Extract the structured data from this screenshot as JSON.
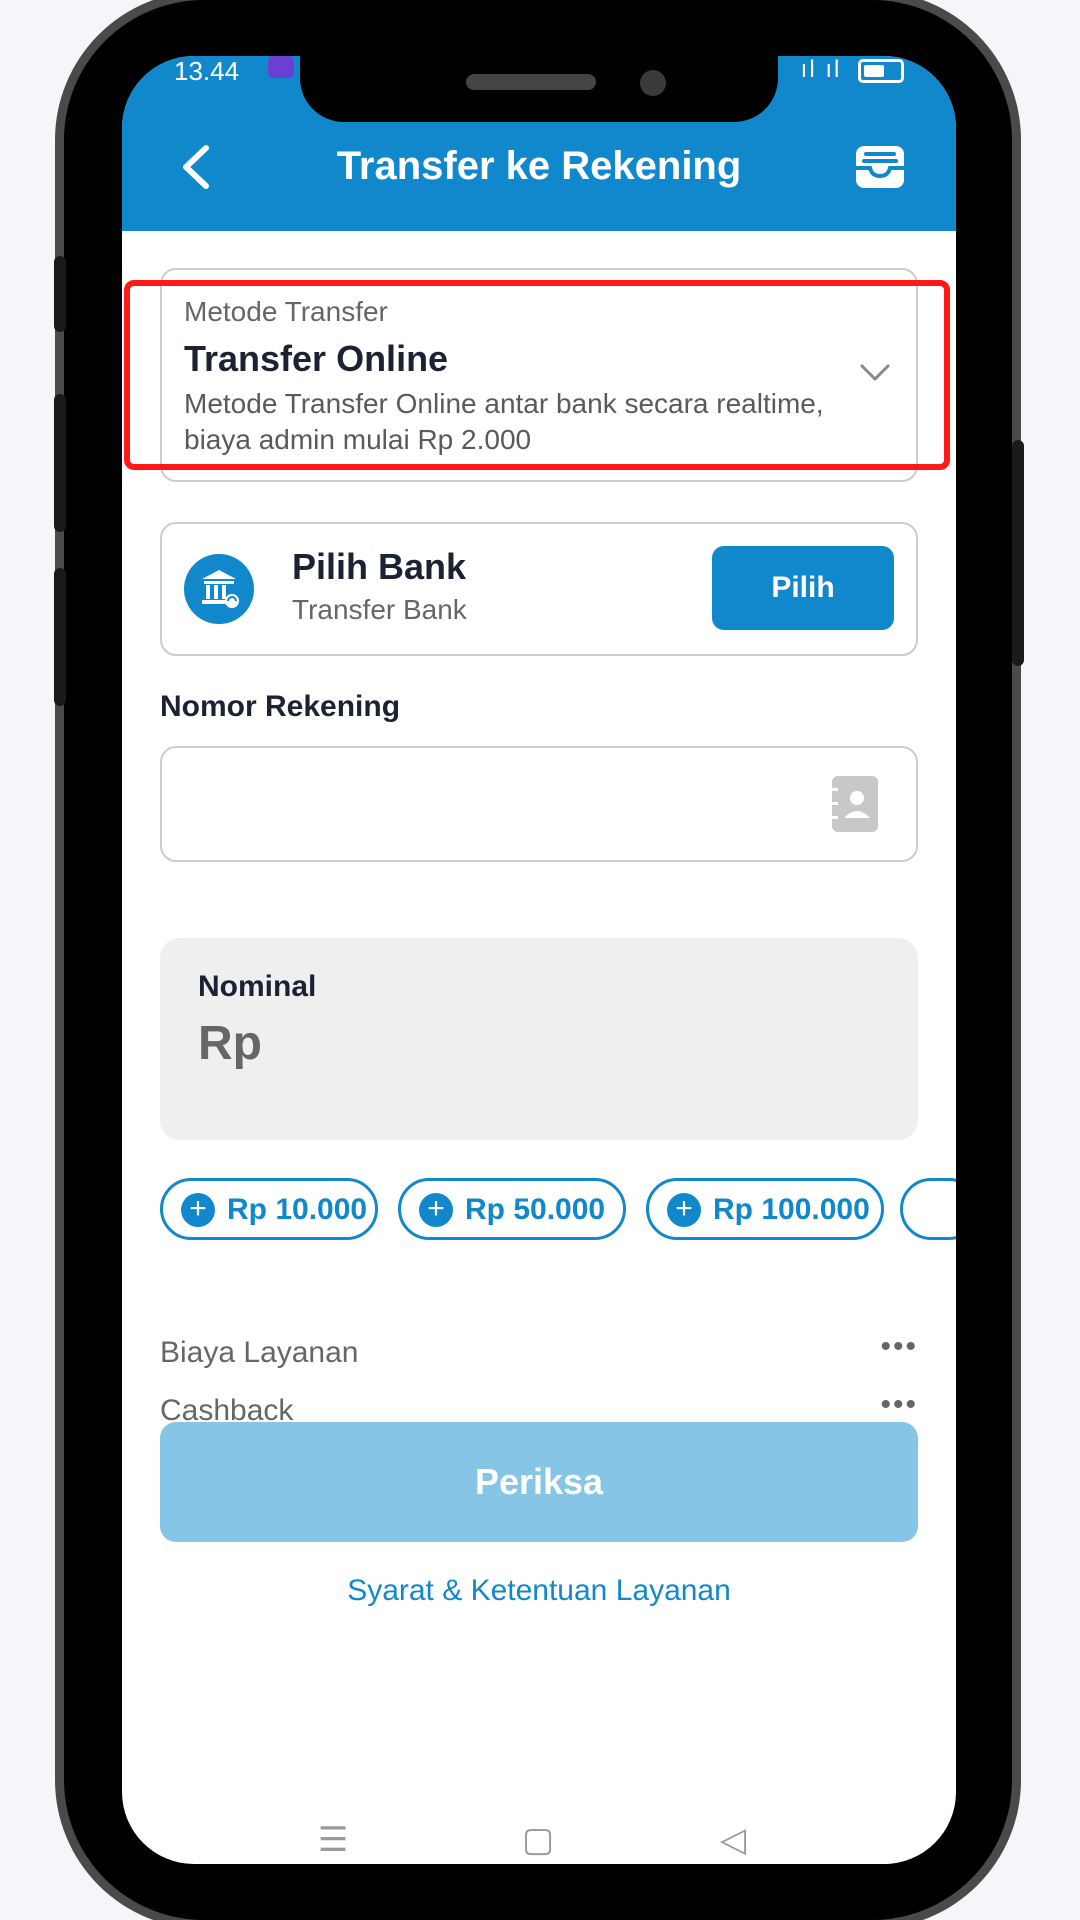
{
  "status_bar": {
    "time": "13.44",
    "signal": "ıl ıl"
  },
  "header": {
    "title": "Transfer ke Rekening"
  },
  "transfer_method": {
    "label": "Metode Transfer",
    "value": "Transfer Online",
    "description": "Metode Transfer Online antar bank secara realtime, biaya admin mulai Rp 2.000"
  },
  "bank": {
    "title": "Pilih Bank",
    "subtitle": "Transfer Bank",
    "button_label": "Pilih"
  },
  "account": {
    "label": "Nomor Rekening",
    "value": "",
    "placeholder": ""
  },
  "nominal": {
    "label": "Nominal",
    "prefix": "Rp",
    "value": ""
  },
  "quick_amounts": [
    "Rp 10.000",
    "Rp 50.000",
    "Rp 100.000"
  ],
  "fees": {
    "service_fee_label": "Biaya Layanan",
    "service_fee_value": "•••",
    "cashback_label": "Cashback",
    "cashback_value": "•••"
  },
  "actions": {
    "check_label": "Periksa",
    "terms_label": "Syarat & Ketentuan Layanan"
  },
  "colors": {
    "primary": "#1188cc",
    "disabled_button": "#86c5e6",
    "highlight": "#ff1a1a"
  }
}
